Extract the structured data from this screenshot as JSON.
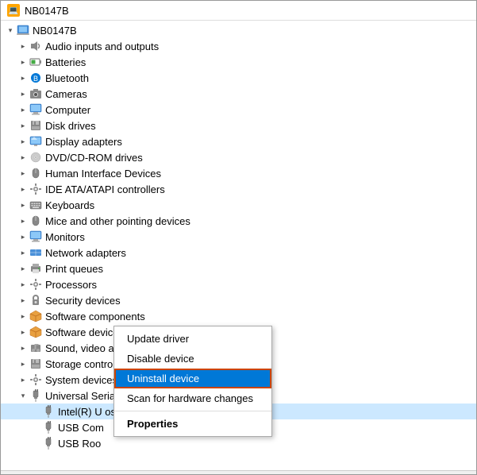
{
  "titleBar": {
    "icon": "💻",
    "title": "NB0147B"
  },
  "treeItems": [
    {
      "id": "root",
      "label": "NB0147B",
      "indent": 0,
      "expand": "expanded",
      "icon": "💻",
      "iconClass": "icon-computer"
    },
    {
      "id": "audio",
      "label": "Audio inputs and outputs",
      "indent": 1,
      "expand": "collapsed",
      "icon": "🔊",
      "iconClass": "icon-audio"
    },
    {
      "id": "batteries",
      "label": "Batteries",
      "indent": 1,
      "expand": "collapsed",
      "icon": "🔋",
      "iconClass": "icon-battery"
    },
    {
      "id": "bluetooth",
      "label": "Bluetooth",
      "indent": 1,
      "expand": "collapsed",
      "icon": "🔵",
      "iconClass": "icon-bluetooth"
    },
    {
      "id": "cameras",
      "label": "Cameras",
      "indent": 1,
      "expand": "collapsed",
      "icon": "📷",
      "iconClass": "icon-audio"
    },
    {
      "id": "computer",
      "label": "Computer",
      "indent": 1,
      "expand": "collapsed",
      "icon": "🖥",
      "iconClass": "icon-computer"
    },
    {
      "id": "disk",
      "label": "Disk drives",
      "indent": 1,
      "expand": "collapsed",
      "icon": "💾",
      "iconClass": "icon-disk"
    },
    {
      "id": "display",
      "label": "Display adapters",
      "indent": 1,
      "expand": "collapsed",
      "icon": "🖵",
      "iconClass": "icon-display"
    },
    {
      "id": "dvd",
      "label": "DVD/CD-ROM drives",
      "indent": 1,
      "expand": "collapsed",
      "icon": "💿",
      "iconClass": "icon-dvd"
    },
    {
      "id": "hid",
      "label": "Human Interface Devices",
      "indent": 1,
      "expand": "collapsed",
      "icon": "🖱",
      "iconClass": "icon-hid"
    },
    {
      "id": "ide",
      "label": "IDE ATA/ATAPI controllers",
      "indent": 1,
      "expand": "collapsed",
      "icon": "⚙",
      "iconClass": "icon-ide"
    },
    {
      "id": "keyboards",
      "label": "Keyboards",
      "indent": 1,
      "expand": "collapsed",
      "icon": "⌨",
      "iconClass": "icon-keyboard"
    },
    {
      "id": "mice",
      "label": "Mice and other pointing devices",
      "indent": 1,
      "expand": "collapsed",
      "icon": "🖱",
      "iconClass": "icon-mice"
    },
    {
      "id": "monitors",
      "label": "Monitors",
      "indent": 1,
      "expand": "collapsed",
      "icon": "🖥",
      "iconClass": "icon-monitor"
    },
    {
      "id": "network",
      "label": "Network adapters",
      "indent": 1,
      "expand": "collapsed",
      "icon": "🌐",
      "iconClass": "icon-network"
    },
    {
      "id": "print",
      "label": "Print queues",
      "indent": 1,
      "expand": "collapsed",
      "icon": "🖨",
      "iconClass": "icon-print"
    },
    {
      "id": "processors",
      "label": "Processors",
      "indent": 1,
      "expand": "collapsed",
      "icon": "⚙",
      "iconClass": "icon-processor"
    },
    {
      "id": "security",
      "label": "Security devices",
      "indent": 1,
      "expand": "collapsed",
      "icon": "🔒",
      "iconClass": "icon-security"
    },
    {
      "id": "swcomp",
      "label": "Software components",
      "indent": 1,
      "expand": "collapsed",
      "icon": "📦",
      "iconClass": "icon-software"
    },
    {
      "id": "swdev",
      "label": "Software devices",
      "indent": 1,
      "expand": "collapsed",
      "icon": "📦",
      "iconClass": "icon-software"
    },
    {
      "id": "sound",
      "label": "Sound, video and game controllers",
      "indent": 1,
      "expand": "collapsed",
      "icon": "🎵",
      "iconClass": "icon-sound"
    },
    {
      "id": "storage",
      "label": "Storage controllers",
      "indent": 1,
      "expand": "collapsed",
      "icon": "💾",
      "iconClass": "icon-storage"
    },
    {
      "id": "sysdev",
      "label": "System devices",
      "indent": 1,
      "expand": "collapsed",
      "icon": "⚙",
      "iconClass": "icon-system"
    },
    {
      "id": "usb",
      "label": "Universal Serial Bus controllers",
      "indent": 1,
      "expand": "expanded",
      "icon": "🔌",
      "iconClass": "icon-usb"
    },
    {
      "id": "intel",
      "label": "Intel(R) U                           osoft)",
      "indent": 2,
      "expand": "none",
      "icon": "🔌",
      "iconClass": "icon-usb-device",
      "selected": true
    },
    {
      "id": "usbcom",
      "label": "USB Com",
      "indent": 2,
      "expand": "none",
      "icon": "🔌",
      "iconClass": "icon-usb-device"
    },
    {
      "id": "usbroot",
      "label": "USB Roo",
      "indent": 2,
      "expand": "none",
      "icon": "🔌",
      "iconClass": "icon-usb-device"
    }
  ],
  "contextMenu": {
    "items": [
      {
        "id": "update",
        "label": "Update driver",
        "type": "normal"
      },
      {
        "id": "disable",
        "label": "Disable device",
        "type": "normal"
      },
      {
        "id": "uninstall",
        "label": "Uninstall device",
        "type": "active"
      },
      {
        "id": "scan",
        "label": "Scan for hardware changes",
        "type": "normal"
      },
      {
        "id": "properties",
        "label": "Properties",
        "type": "bold"
      }
    ]
  },
  "statusBar": {
    "text": ""
  }
}
